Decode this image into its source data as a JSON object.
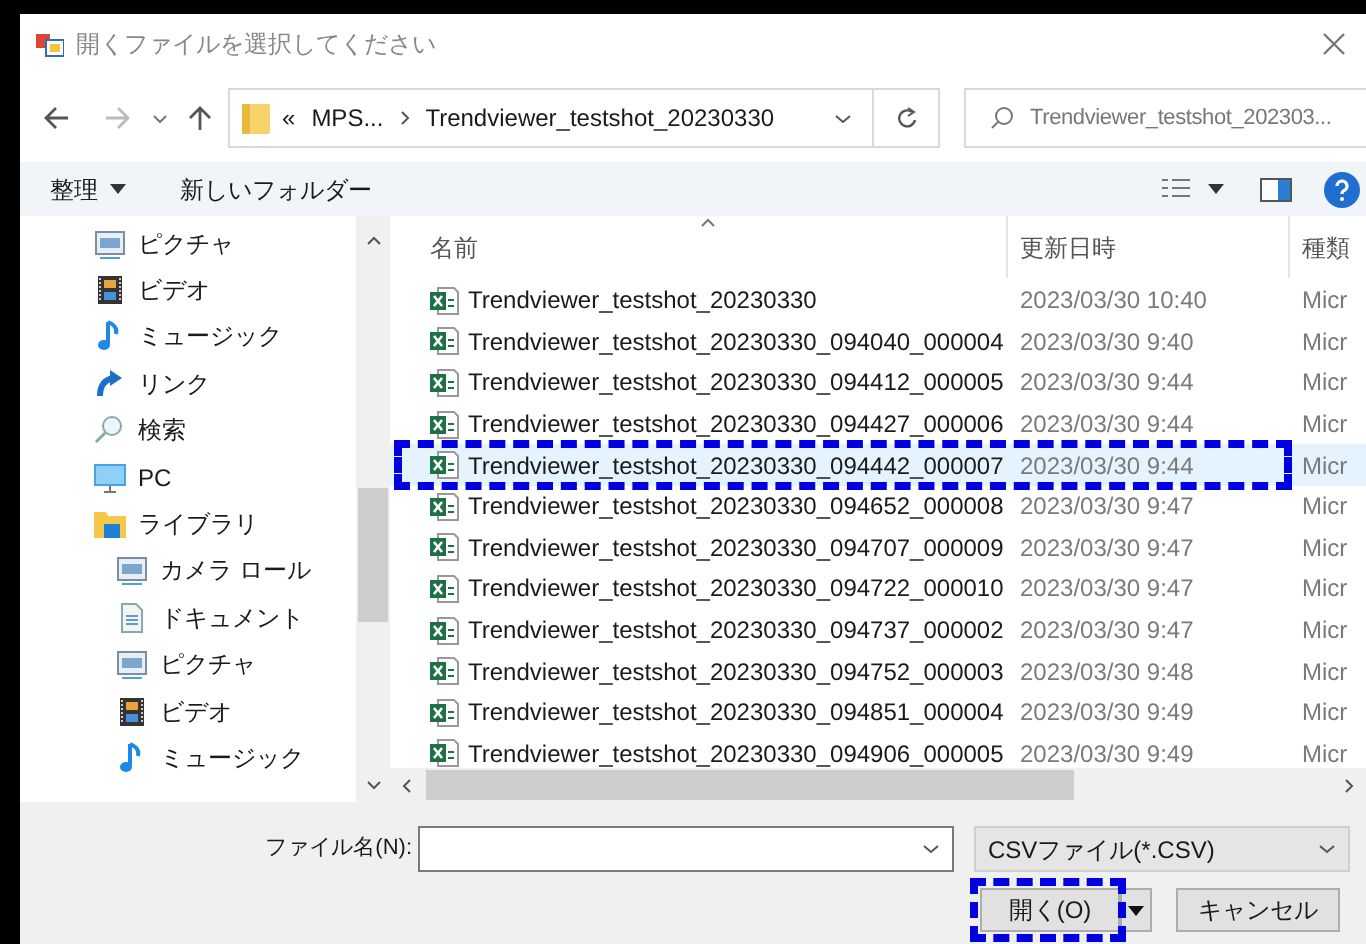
{
  "window": {
    "title": "開くファイルを選択してください"
  },
  "address": {
    "overflow": "«",
    "path": [
      "MPS...",
      "Trendviewer_testshot_20230330"
    ]
  },
  "search": {
    "placeholder": "Trendviewer_testshot_202303..."
  },
  "toolbar": {
    "organize": "整理",
    "new_folder": "新しいフォルダー"
  },
  "sidebar": {
    "items": [
      {
        "children": [
          {
            "label": "ピクチャ",
            "kind": "pictures"
          },
          {
            "label": "ビデオ",
            "kind": "video"
          },
          {
            "label": "ミュージック",
            "kind": "music"
          },
          {
            "label": "リンク",
            "kind": "link"
          },
          {
            "label": "検索",
            "kind": "search"
          }
        ]
      },
      {
        "label": "PC",
        "kind": "pc"
      },
      {
        "label": "ライブラリ",
        "kind": "library",
        "children": [
          {
            "label": "カメラ ロール",
            "kind": "pictures"
          },
          {
            "label": "ドキュメント",
            "kind": "document"
          },
          {
            "label": "ピクチャ",
            "kind": "pictures"
          },
          {
            "label": "ビデオ",
            "kind": "video"
          },
          {
            "label": "ミュージック",
            "kind": "music"
          }
        ]
      }
    ]
  },
  "table": {
    "columns": [
      "名前",
      "更新日時",
      "種類"
    ],
    "rows": [
      {
        "name": "Trendviewer_testshot_20230330",
        "date": "2023/03/30 10:40",
        "column_3": "Micr",
        "selected": false,
        "highlighted": false
      },
      {
        "name": "Trendviewer_testshot_20230330_094040_000004",
        "date": "2023/03/30 9:40",
        "column_3": "Micr",
        "selected": false,
        "highlighted": false
      },
      {
        "name": "Trendviewer_testshot_20230330_094412_000005",
        "date": "2023/03/30 9:44",
        "column_3": "Micr",
        "selected": false,
        "highlighted": false
      },
      {
        "name": "Trendviewer_testshot_20230330_094427_000006",
        "date": "2023/03/30 9:44",
        "column_3": "Micr",
        "selected": false,
        "highlighted": false
      },
      {
        "name": "Trendviewer_testshot_20230330_094442_000007",
        "date": "2023/03/30 9:44",
        "column_3": "Micr",
        "selected": true,
        "highlighted": true
      },
      {
        "name": "Trendviewer_testshot_20230330_094652_000008",
        "date": "2023/03/30 9:47",
        "column_3": "Micr",
        "selected": false,
        "highlighted": false
      },
      {
        "name": "Trendviewer_testshot_20230330_094707_000009",
        "date": "2023/03/30 9:47",
        "column_3": "Micr",
        "selected": false,
        "highlighted": false
      },
      {
        "name": "Trendviewer_testshot_20230330_094722_000010",
        "date": "2023/03/30 9:47",
        "column_3": "Micr",
        "selected": false,
        "highlighted": false
      },
      {
        "name": "Trendviewer_testshot_20230330_094737_000002",
        "date": "2023/03/30 9:47",
        "column_3": "Micr",
        "selected": false,
        "highlighted": false
      },
      {
        "name": "Trendviewer_testshot_20230330_094752_000003",
        "date": "2023/03/30 9:48",
        "column_3": "Micr",
        "selected": false,
        "highlighted": false
      },
      {
        "name": "Trendviewer_testshot_20230330_094851_000004",
        "date": "2023/03/30 9:49",
        "column_3": "Micr",
        "selected": false,
        "highlighted": false
      },
      {
        "name": "Trendviewer_testshot_20230330_094906_000005",
        "date": "2023/03/30 9:49",
        "column_3": "Micr",
        "selected": false,
        "highlighted": false
      }
    ]
  },
  "filename": {
    "label": "ファイル名(N):"
  },
  "filetype": {
    "value": "CSVファイル(*.CSV)"
  },
  "buttons": [
    {
      "label": "開く(O)",
      "kind": "split",
      "highlighted": true
    },
    {
      "label": "キャンセル",
      "kind": "plain",
      "highlighted": false
    }
  ]
}
